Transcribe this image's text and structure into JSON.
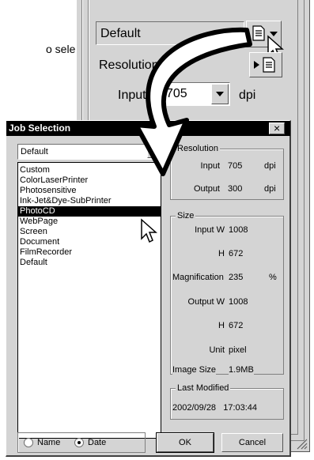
{
  "caption_fragment": "o selec-",
  "background_panel": {
    "preset_value": "Default",
    "resolution_label": "Resolution",
    "input_label": "Input",
    "input_value": "705",
    "input_unit": "dpi"
  },
  "dialog": {
    "title": "Job Selection",
    "close_glyph": "×",
    "job_dropdown_value": "Default",
    "job_list": [
      "Custom",
      "ColorLaserPrinter",
      "Photosensitive",
      "Ink-Jet&Dye-SubPrinter",
      "PhotoCD",
      "WebPage",
      "Screen",
      "Document",
      "FilmRecorder",
      "Default"
    ],
    "selected_job": "PhotoCD",
    "resolution": {
      "group_label": "Resolution",
      "input_label": "Input",
      "input_value": "705",
      "input_unit": "dpi",
      "output_label": "Output",
      "output_value": "300",
      "output_unit": "dpi"
    },
    "size": {
      "group_label": "Size",
      "input_w_label": "Input W",
      "input_w_value": "1008",
      "input_h_label": "H",
      "input_h_value": "672",
      "magnification_label": "Magnification",
      "magnification_value": "235",
      "magnification_unit": "%",
      "output_w_label": "Output W",
      "output_w_value": "1008",
      "output_h_label": "H",
      "output_h_value": "672",
      "unit_label": "Unit",
      "unit_value": "pixel",
      "image_size_label": "Image Size",
      "image_size_value": "1.9MB"
    },
    "last_modified": {
      "group_label": "Last Modified",
      "value": "2002/09/28   17:03:44"
    },
    "sort": {
      "name_label": "Name",
      "date_label": "Date",
      "selected": "Date"
    },
    "ok_label": "OK",
    "cancel_label": "Cancel"
  },
  "colors": {
    "window_face": "#d4d4d4",
    "title_bar": "#000000",
    "selection": "#000000"
  }
}
